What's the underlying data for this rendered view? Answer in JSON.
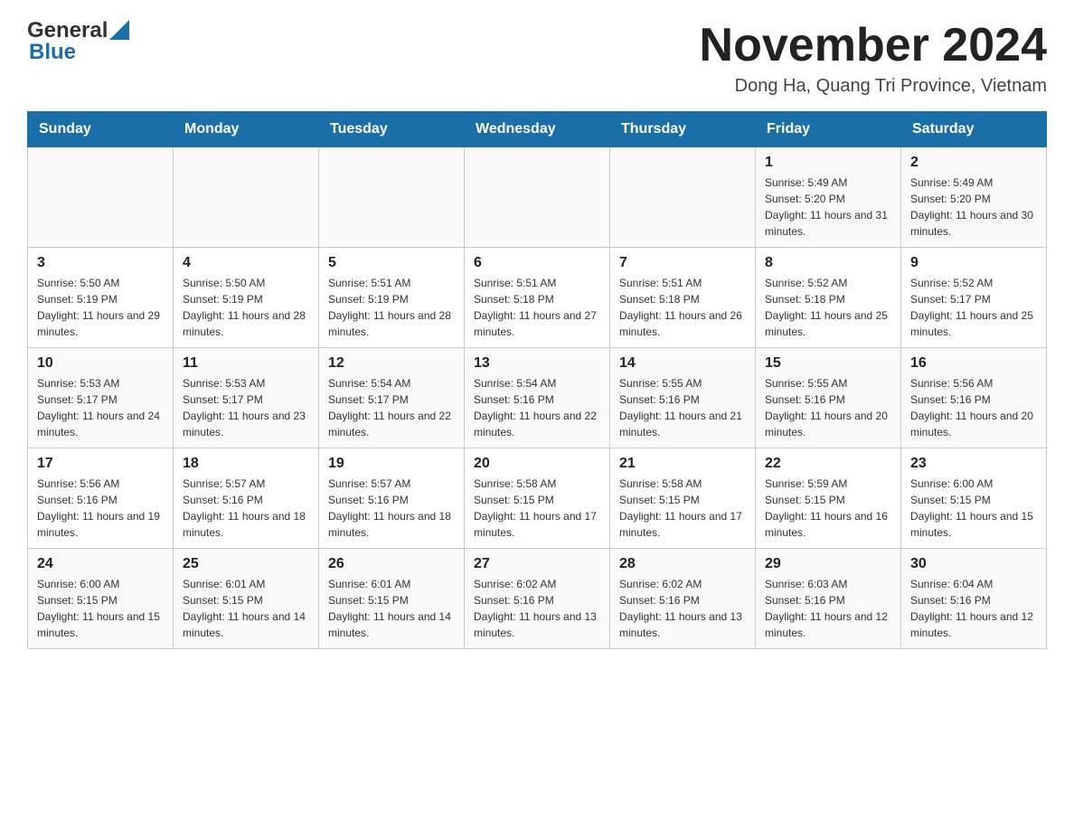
{
  "logo": {
    "general": "General",
    "triangle": "▲",
    "blue": "Blue"
  },
  "header": {
    "title": "November 2024",
    "subtitle": "Dong Ha, Quang Tri Province, Vietnam"
  },
  "days_of_week": [
    "Sunday",
    "Monday",
    "Tuesday",
    "Wednesday",
    "Thursday",
    "Friday",
    "Saturday"
  ],
  "weeks": [
    {
      "days": [
        {
          "number": "",
          "info": ""
        },
        {
          "number": "",
          "info": ""
        },
        {
          "number": "",
          "info": ""
        },
        {
          "number": "",
          "info": ""
        },
        {
          "number": "",
          "info": ""
        },
        {
          "number": "1",
          "info": "Sunrise: 5:49 AM\nSunset: 5:20 PM\nDaylight: 11 hours and 31 minutes."
        },
        {
          "number": "2",
          "info": "Sunrise: 5:49 AM\nSunset: 5:20 PM\nDaylight: 11 hours and 30 minutes."
        }
      ]
    },
    {
      "days": [
        {
          "number": "3",
          "info": "Sunrise: 5:50 AM\nSunset: 5:19 PM\nDaylight: 11 hours and 29 minutes."
        },
        {
          "number": "4",
          "info": "Sunrise: 5:50 AM\nSunset: 5:19 PM\nDaylight: 11 hours and 28 minutes."
        },
        {
          "number": "5",
          "info": "Sunrise: 5:51 AM\nSunset: 5:19 PM\nDaylight: 11 hours and 28 minutes."
        },
        {
          "number": "6",
          "info": "Sunrise: 5:51 AM\nSunset: 5:18 PM\nDaylight: 11 hours and 27 minutes."
        },
        {
          "number": "7",
          "info": "Sunrise: 5:51 AM\nSunset: 5:18 PM\nDaylight: 11 hours and 26 minutes."
        },
        {
          "number": "8",
          "info": "Sunrise: 5:52 AM\nSunset: 5:18 PM\nDaylight: 11 hours and 25 minutes."
        },
        {
          "number": "9",
          "info": "Sunrise: 5:52 AM\nSunset: 5:17 PM\nDaylight: 11 hours and 25 minutes."
        }
      ]
    },
    {
      "days": [
        {
          "number": "10",
          "info": "Sunrise: 5:53 AM\nSunset: 5:17 PM\nDaylight: 11 hours and 24 minutes."
        },
        {
          "number": "11",
          "info": "Sunrise: 5:53 AM\nSunset: 5:17 PM\nDaylight: 11 hours and 23 minutes."
        },
        {
          "number": "12",
          "info": "Sunrise: 5:54 AM\nSunset: 5:17 PM\nDaylight: 11 hours and 22 minutes."
        },
        {
          "number": "13",
          "info": "Sunrise: 5:54 AM\nSunset: 5:16 PM\nDaylight: 11 hours and 22 minutes."
        },
        {
          "number": "14",
          "info": "Sunrise: 5:55 AM\nSunset: 5:16 PM\nDaylight: 11 hours and 21 minutes."
        },
        {
          "number": "15",
          "info": "Sunrise: 5:55 AM\nSunset: 5:16 PM\nDaylight: 11 hours and 20 minutes."
        },
        {
          "number": "16",
          "info": "Sunrise: 5:56 AM\nSunset: 5:16 PM\nDaylight: 11 hours and 20 minutes."
        }
      ]
    },
    {
      "days": [
        {
          "number": "17",
          "info": "Sunrise: 5:56 AM\nSunset: 5:16 PM\nDaylight: 11 hours and 19 minutes."
        },
        {
          "number": "18",
          "info": "Sunrise: 5:57 AM\nSunset: 5:16 PM\nDaylight: 11 hours and 18 minutes."
        },
        {
          "number": "19",
          "info": "Sunrise: 5:57 AM\nSunset: 5:16 PM\nDaylight: 11 hours and 18 minutes."
        },
        {
          "number": "20",
          "info": "Sunrise: 5:58 AM\nSunset: 5:15 PM\nDaylight: 11 hours and 17 minutes."
        },
        {
          "number": "21",
          "info": "Sunrise: 5:58 AM\nSunset: 5:15 PM\nDaylight: 11 hours and 17 minutes."
        },
        {
          "number": "22",
          "info": "Sunrise: 5:59 AM\nSunset: 5:15 PM\nDaylight: 11 hours and 16 minutes."
        },
        {
          "number": "23",
          "info": "Sunrise: 6:00 AM\nSunset: 5:15 PM\nDaylight: 11 hours and 15 minutes."
        }
      ]
    },
    {
      "days": [
        {
          "number": "24",
          "info": "Sunrise: 6:00 AM\nSunset: 5:15 PM\nDaylight: 11 hours and 15 minutes."
        },
        {
          "number": "25",
          "info": "Sunrise: 6:01 AM\nSunset: 5:15 PM\nDaylight: 11 hours and 14 minutes."
        },
        {
          "number": "26",
          "info": "Sunrise: 6:01 AM\nSunset: 5:15 PM\nDaylight: 11 hours and 14 minutes."
        },
        {
          "number": "27",
          "info": "Sunrise: 6:02 AM\nSunset: 5:16 PM\nDaylight: 11 hours and 13 minutes."
        },
        {
          "number": "28",
          "info": "Sunrise: 6:02 AM\nSunset: 5:16 PM\nDaylight: 11 hours and 13 minutes."
        },
        {
          "number": "29",
          "info": "Sunrise: 6:03 AM\nSunset: 5:16 PM\nDaylight: 11 hours and 12 minutes."
        },
        {
          "number": "30",
          "info": "Sunrise: 6:04 AM\nSunset: 5:16 PM\nDaylight: 11 hours and 12 minutes."
        }
      ]
    }
  ]
}
